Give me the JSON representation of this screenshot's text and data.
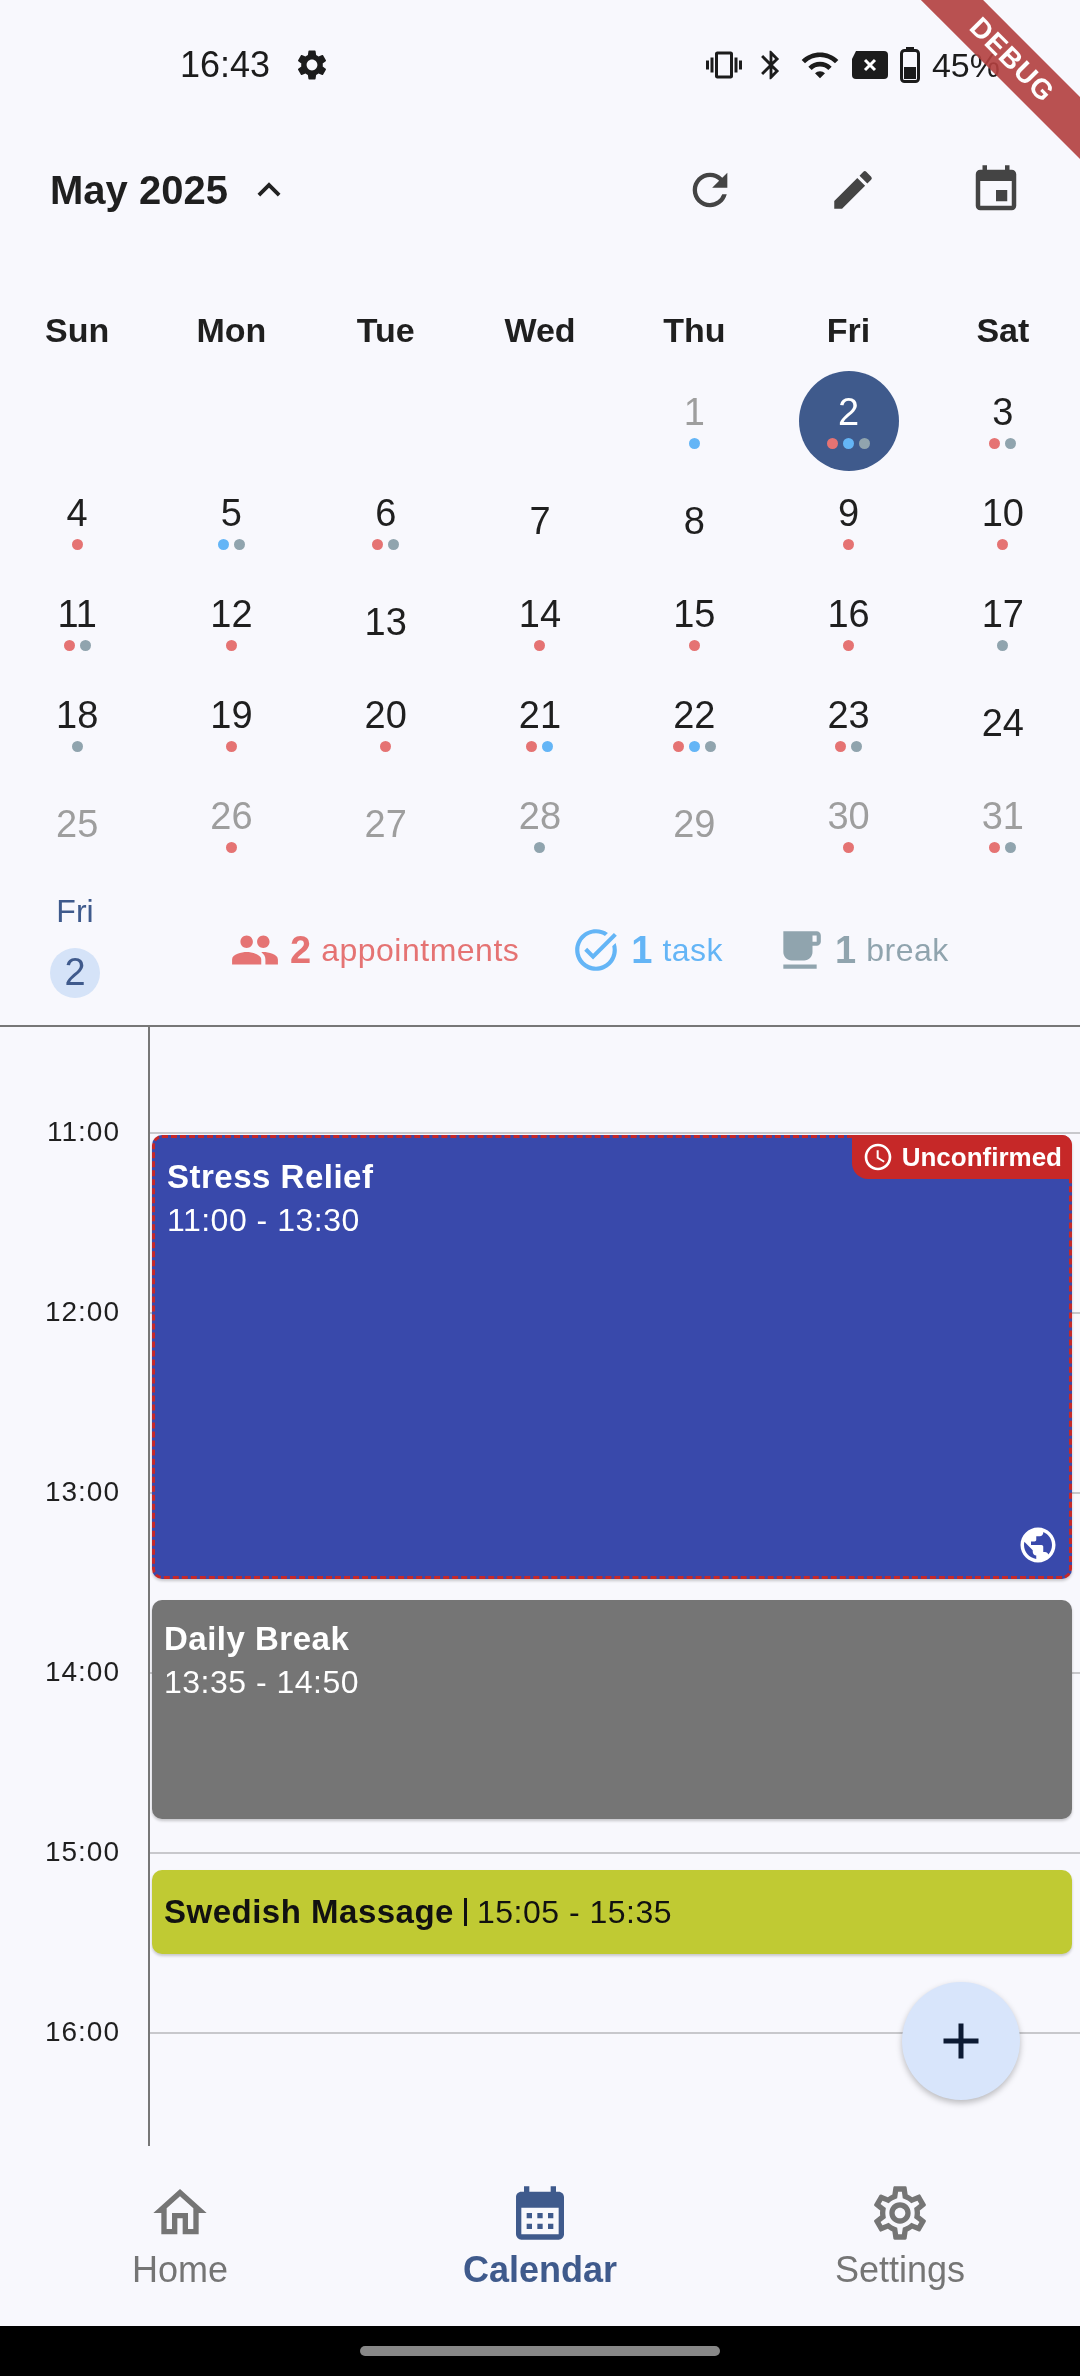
{
  "status_bar": {
    "time": "16:43",
    "battery": "45%"
  },
  "debug_banner": "DEBUG",
  "header": {
    "title": "May 2025",
    "expanded": true
  },
  "weekdays": [
    "Sun",
    "Mon",
    "Tue",
    "Wed",
    "Thu",
    "Fri",
    "Sat"
  ],
  "days": [
    {
      "label": "1",
      "muted": true,
      "selected": false,
      "dots": [
        {
          "color": "#64b5f6"
        }
      ]
    },
    {
      "label": "2",
      "muted": false,
      "selected": true,
      "dots": [
        {
          "color": "#e57373"
        },
        {
          "color": "#64b5f6"
        },
        {
          "color": "#90a4ae"
        }
      ]
    },
    {
      "label": "3",
      "muted": false,
      "selected": false,
      "dots": [
        {
          "color": "#e57373"
        },
        {
          "color": "#90a4ae"
        }
      ]
    },
    {
      "label": "4",
      "muted": false,
      "selected": false,
      "dots": [
        {
          "color": "#e57373"
        }
      ]
    },
    {
      "label": "5",
      "muted": false,
      "selected": false,
      "dots": [
        {
          "color": "#64b5f6"
        },
        {
          "color": "#90a4ae"
        }
      ]
    },
    {
      "label": "6",
      "muted": false,
      "selected": false,
      "dots": [
        {
          "color": "#e57373"
        },
        {
          "color": "#90a4ae"
        }
      ]
    },
    {
      "label": "7",
      "muted": false,
      "selected": false
    },
    {
      "label": "8",
      "muted": false,
      "selected": false
    },
    {
      "label": "9",
      "muted": false,
      "selected": false,
      "dots": [
        {
          "color": "#e57373"
        }
      ]
    },
    {
      "label": "10",
      "muted": false,
      "selected": false,
      "dots": [
        {
          "color": "#e57373"
        }
      ]
    },
    {
      "label": "11",
      "muted": false,
      "selected": false,
      "dots": [
        {
          "color": "#e57373"
        },
        {
          "color": "#90a4ae"
        }
      ]
    },
    {
      "label": "12",
      "muted": false,
      "selected": false,
      "dots": [
        {
          "color": "#e57373"
        }
      ]
    },
    {
      "label": "13",
      "muted": false,
      "selected": false
    },
    {
      "label": "14",
      "muted": false,
      "selected": false,
      "dots": [
        {
          "color": "#e57373"
        }
      ]
    },
    {
      "label": "15",
      "muted": false,
      "selected": false,
      "dots": [
        {
          "color": "#e57373"
        }
      ]
    },
    {
      "label": "16",
      "muted": false,
      "selected": false,
      "dots": [
        {
          "color": "#e57373"
        }
      ]
    },
    {
      "label": "17",
      "muted": false,
      "selected": false,
      "dots": [
        {
          "color": "#90a4ae"
        }
      ]
    },
    {
      "label": "18",
      "muted": false,
      "selected": false,
      "dots": [
        {
          "color": "#90a4ae"
        }
      ]
    },
    {
      "label": "19",
      "muted": false,
      "selected": false,
      "dots": [
        {
          "color": "#e57373"
        }
      ]
    },
    {
      "label": "20",
      "muted": false,
      "selected": false,
      "dots": [
        {
          "color": "#e57373"
        }
      ]
    },
    {
      "label": "21",
      "muted": false,
      "selected": false,
      "dots": [
        {
          "color": "#e57373"
        },
        {
          "color": "#64b5f6"
        }
      ]
    },
    {
      "label": "22",
      "muted": false,
      "selected": false,
      "dots": [
        {
          "color": "#e57373"
        },
        {
          "color": "#64b5f6"
        },
        {
          "color": "#90a4ae"
        }
      ]
    },
    {
      "label": "23",
      "muted": false,
      "selected": false,
      "dots": [
        {
          "color": "#e57373"
        },
        {
          "color": "#90a4ae"
        }
      ]
    },
    {
      "label": "24",
      "muted": false,
      "selected": false
    },
    {
      "label": "25",
      "muted": true,
      "selected": false
    },
    {
      "label": "26",
      "muted": true,
      "selected": false,
      "dots": [
        {
          "color": "#e57373"
        }
      ]
    },
    {
      "label": "27",
      "muted": true,
      "selected": false
    },
    {
      "label": "28",
      "muted": true,
      "selected": false,
      "dots": [
        {
          "color": "#90a4ae"
        }
      ]
    },
    {
      "label": "29",
      "muted": true,
      "selected": false
    },
    {
      "label": "30",
      "muted": true,
      "selected": false,
      "dots": [
        {
          "color": "#e57373"
        }
      ]
    },
    {
      "label": "31",
      "muted": true,
      "selected": false,
      "dots": [
        {
          "color": "#e57373"
        },
        {
          "color": "#90a4ae"
        }
      ]
    }
  ],
  "selected_day": {
    "weekday": "Fri",
    "day": "2"
  },
  "summary": [
    {
      "kind": "appointment",
      "count": "2",
      "label": "appointments",
      "color": "#e57373"
    },
    {
      "kind": "task",
      "count": "1",
      "label": "task",
      "color": "#64b5f6"
    },
    {
      "kind": "break",
      "count": "1",
      "label": "break",
      "color": "#90a4ae"
    }
  ],
  "timeline": {
    "hours": [
      "11:00",
      "12:00",
      "13:00",
      "14:00",
      "15:00",
      "16:00"
    ],
    "events": [
      {
        "kind": "full",
        "title": "Stress Relief",
        "time": "11:00 - 13:30",
        "color": "#3949ab",
        "unconfirmed": true,
        "badge": "Unconfirmed",
        "online": true
      },
      {
        "kind": "full",
        "title": "Daily Break",
        "time": "13:35 - 14:50",
        "color": "#757575",
        "unconfirmed": false,
        "online": false
      },
      {
        "kind": "compact",
        "title": "Swedish Massage",
        "time": "15:05 - 15:35",
        "color": "#c0ca33",
        "unconfirmed": false,
        "online": false
      }
    ]
  },
  "nav": [
    {
      "kind": "home",
      "label": "Home",
      "selected": false
    },
    {
      "kind": "calendar",
      "label": "Calendar",
      "selected": true
    },
    {
      "kind": "settings",
      "label": "Settings",
      "selected": false
    }
  ]
}
